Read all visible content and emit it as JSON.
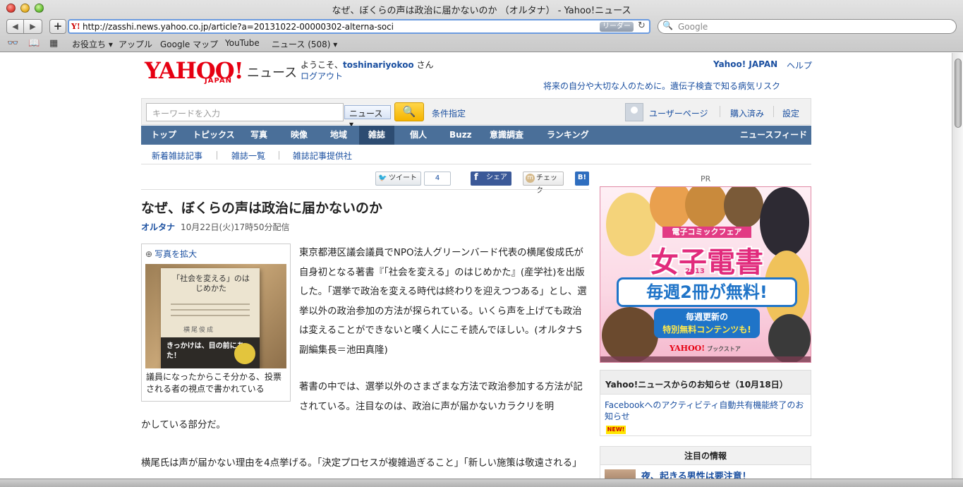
{
  "window": {
    "title": "なぜ、ぼくらの声は政治に届かないのか （オルタナ） - Yahoo!ニュース"
  },
  "toolbar": {
    "back_icon": "◀",
    "forward_icon": "▶",
    "add_icon": "+",
    "favicon": "Y!",
    "url": "http://zasshi.news.yahoo.co.jp/article?a=20131022-00000302-alterna-soci",
    "reader_label": "リーダー",
    "reload_icon": "↻",
    "search_placeholder": "Google",
    "search_icon": "🔍"
  },
  "bookmarks": {
    "items": [
      "お役立ち ▾",
      "アップル",
      "Google マップ",
      "YouTube",
      "ニュース (508) ▾"
    ]
  },
  "header": {
    "logo": "YAHOO!",
    "logo_sub": "JAPAN",
    "section": "ニュース",
    "welcome_prefix": "ようこそ、",
    "username": "toshinariyokoo",
    "welcome_suffix": " さん",
    "logout": "ログアウト",
    "yahoo_japan": "Yahoo! JAPAN",
    "help": "ヘルプ",
    "promo": "将来の自分や大切な人のために。遺伝子検査で知る病気リスク"
  },
  "search": {
    "placeholder": "キーワードを入力",
    "category": "ニュース",
    "button_icon": "🔍",
    "conditions": "条件指定",
    "user_page": "ユーザーページ",
    "purchased": "購入済み",
    "settings": "設定"
  },
  "gnav": {
    "items": [
      "トップ",
      "トピックス",
      "写真",
      "映像",
      "地域",
      "雑誌",
      "個人",
      "Buzz",
      "意識調査",
      "ランキング"
    ],
    "feed": "ニュースフィード"
  },
  "subnav": {
    "items": [
      "新着雑誌記事",
      "雑誌一覧",
      "雑誌記事提供社"
    ]
  },
  "social": {
    "tweet": "ツイート",
    "tweet_count": "4",
    "facebook": "シェア",
    "mixi": "チェック",
    "hatena": "B!"
  },
  "article": {
    "headline": "なぜ、ぼくらの声は政治に届かないのか",
    "source": "オルタナ",
    "date": "10月22日(火)17時50分配信",
    "enlarge": "写真を拡大",
    "photo_book_title": "「社会を変える」のはじめかた",
    "photo_book_author": "横尾俊成",
    "photo_band": "きっかけは、目の前にあった！",
    "caption": "議員になったからこそ分かる、投票される者の視点で書かれている",
    "p1": "東京都港区議会議員でNPO法人グリーンバード代表の横尾俊成氏が自身初となる著書『「社会を変える」のはじめかた』(産学社)を出版した。「選挙で政治を変える時代は終わりを迎えつつある」とし、選挙以外の政治参加の方法が探られている。いくら声を上げても政治は変えることができないと嘆く人にこそ読んでほしい。(オルタナS副編集長＝池田真隆)",
    "p2": "著書の中では、選挙以外のさまざまな方法で政治参加する方法が記されている。注目なのは、政治に声が届かないカラクリを明",
    "p2b": "かしている部分だ。",
    "p3": "横尾氏は声が届かない理由を4点挙げる。「決定プロセスが複雑過ぎること」「新しい施策は敬遠される」"
  },
  "sidebar": {
    "pr": "PR",
    "ad": {
      "fair": "電子コミックフェア",
      "title": "女子電書",
      "year": "2013",
      "weekly": "毎週2冊が無料!",
      "update_line1": "毎週更新の",
      "update_line2": "特別無料コンテンツも!",
      "logo": "YAHOO!",
      "store": "ブックストア"
    },
    "notice_title": "Yahoo!ニュースからのお知らせ（10月18日）",
    "notice_link": "Facebookへのアクティビティ自動共有機能終了のお知らせ",
    "notice_badge": "NEW!",
    "attention_title": "注目の情報",
    "attention_item": "夜、起きる男性は要注意！"
  }
}
